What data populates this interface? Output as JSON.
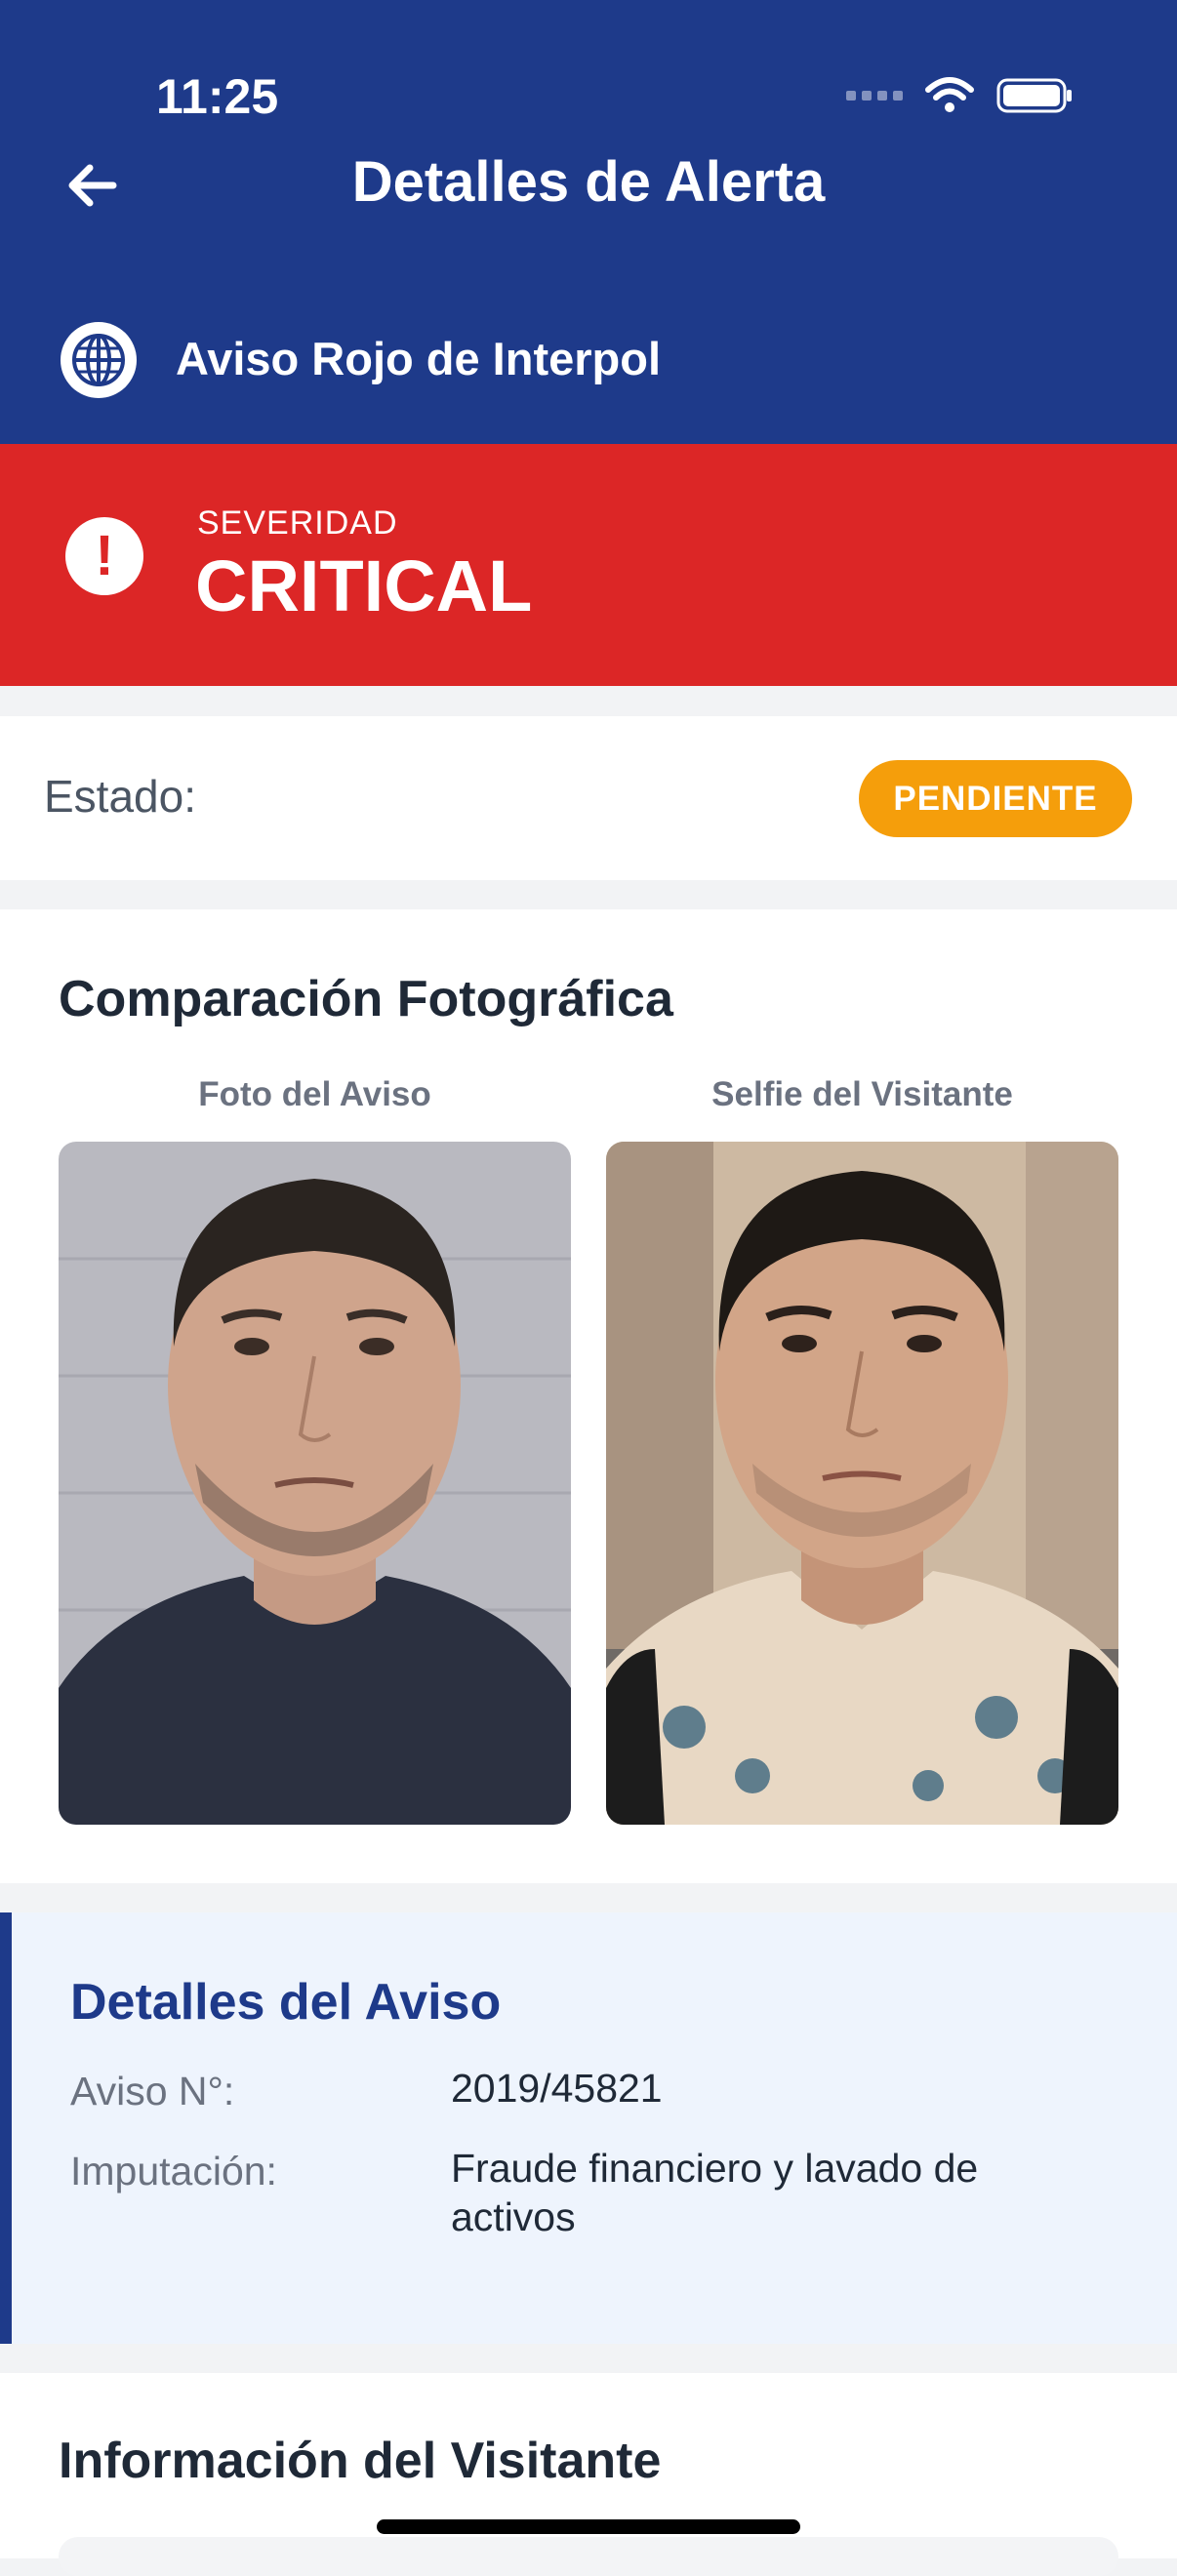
{
  "status_bar": {
    "time": "11:25"
  },
  "header": {
    "title": "Detalles de Alerta",
    "source": "Aviso Rojo de Interpol"
  },
  "severity": {
    "label": "SEVERIDAD",
    "value": "CRITICAL",
    "color": "#dc2626"
  },
  "status": {
    "label": "Estado:",
    "badge": "PENDIENTE",
    "badge_color": "#f59e0b"
  },
  "photo_comparison": {
    "title": "Comparación Fotográfica",
    "notice_photo_caption": "Foto del Aviso",
    "visitor_selfie_caption": "Selfie del Visitante"
  },
  "notice_details": {
    "title": "Detalles del Aviso",
    "rows": [
      {
        "label": "Aviso N°:",
        "value": "2019/45821"
      },
      {
        "label": "Imputación:",
        "value": "Fraude financiero y lavado de activos"
      }
    ]
  },
  "visitor_info": {
    "title": "Información del Visitante"
  },
  "colors": {
    "primary": "#1e3a8a",
    "critical": "#dc2626",
    "pending": "#f59e0b"
  },
  "icons": {
    "back": "arrow-left-icon",
    "source": "globe-icon",
    "severity": "exclamation-icon"
  }
}
